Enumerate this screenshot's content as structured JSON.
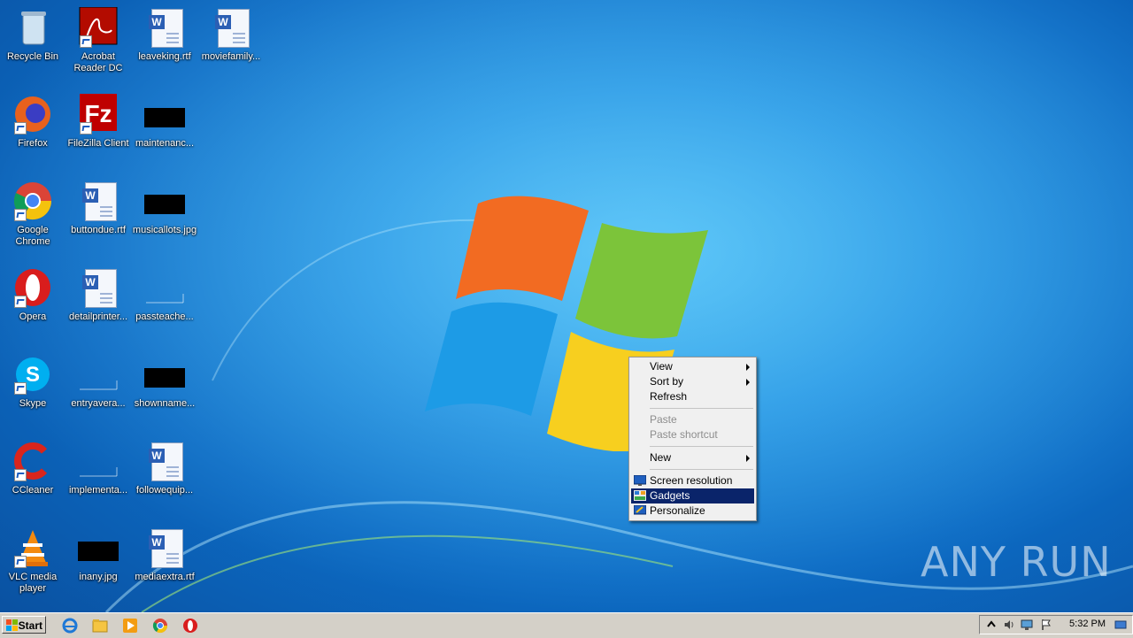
{
  "desktop_icons": [
    {
      "label": "Recycle Bin"
    },
    {
      "label": "Acrobat Reader DC"
    },
    {
      "label": "leaveking.rtf"
    },
    {
      "label": "moviefamily..."
    },
    {
      "label": "Firefox"
    },
    {
      "label": "FileZilla Client"
    },
    {
      "label": "maintenanc..."
    },
    {
      "label": "Google Chrome"
    },
    {
      "label": "buttondue.rtf"
    },
    {
      "label": "musicallots.jpg"
    },
    {
      "label": "Opera"
    },
    {
      "label": "detailprinter..."
    },
    {
      "label": "passteache..."
    },
    {
      "label": "Skype"
    },
    {
      "label": "entryavera..."
    },
    {
      "label": "shownname..."
    },
    {
      "label": "CCleaner"
    },
    {
      "label": "implementa..."
    },
    {
      "label": "followequip..."
    },
    {
      "label": "VLC media player"
    },
    {
      "label": "inany.jpg"
    },
    {
      "label": "mediaextra.rtf"
    }
  ],
  "context_menu": {
    "items": [
      {
        "label": "View"
      },
      {
        "label": "Sort by"
      },
      {
        "label": "Refresh"
      },
      {
        "label": "Paste"
      },
      {
        "label": "Paste shortcut"
      },
      {
        "label": "New"
      },
      {
        "label": "Screen resolution"
      },
      {
        "label": "Gadgets"
      },
      {
        "label": "Personalize"
      }
    ],
    "highlighted": "Gadgets"
  },
  "taskbar": {
    "start_label": "Start",
    "clock": "5:32 PM",
    "quick_launch": [
      "ie-icon",
      "explorer-icon",
      "media-player-icon",
      "chrome-icon",
      "opera-icon"
    ]
  },
  "watermark": "ANY RUN",
  "colors": {
    "menu_highlight": "#0a246a",
    "taskbar": "#d4d0c8"
  }
}
